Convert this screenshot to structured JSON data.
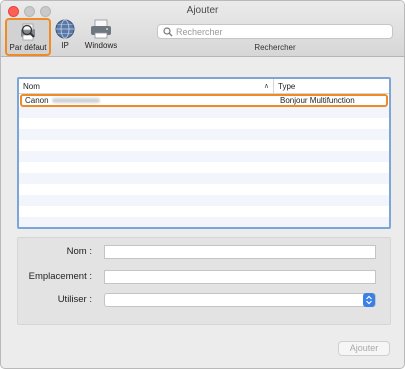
{
  "window": {
    "title": "Ajouter"
  },
  "toolbar": {
    "items": [
      {
        "label": "Par défaut",
        "icon": "default-printer-icon",
        "selected": true
      },
      {
        "label": "IP",
        "icon": "globe-network-icon"
      },
      {
        "label": "Windows",
        "icon": "windows-printer-icon"
      }
    ],
    "search": {
      "placeholder": "Rechercher",
      "caption": "Rechercher"
    }
  },
  "list": {
    "columns": {
      "name": "Nom",
      "type": "Type"
    },
    "rows": [
      {
        "name": "Canon",
        "type": "Bonjour Multifunction",
        "selected": true
      }
    ]
  },
  "form": {
    "name_label": "Nom :",
    "location_label": "Emplacement :",
    "use_label": "Utiliser :"
  },
  "buttons": {
    "add": "Ajouter"
  },
  "colors": {
    "highlight": "#f08a24",
    "list_border": "#7da6d8",
    "stepper": "#3b7fe8"
  }
}
